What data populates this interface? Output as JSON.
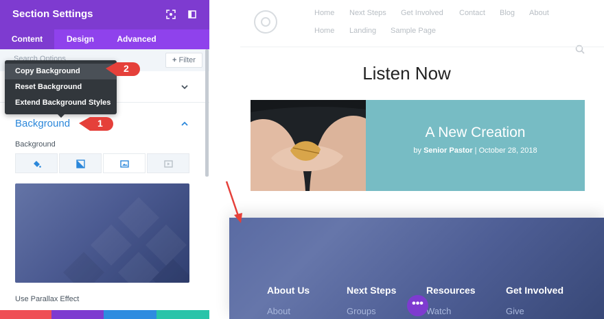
{
  "panel": {
    "title": "Section Settings",
    "tabs": [
      "Content",
      "Design",
      "Advanced"
    ],
    "active_tab": "Content",
    "search_placeholder": "Search Options",
    "filter_label": "Filter",
    "background_section_title": "Background",
    "background_field_label": "Background",
    "background_type_tabs": [
      "paint-bucket-icon",
      "gradient-icon",
      "image-icon",
      "video-icon"
    ],
    "parallax_label": "Use Parallax Effect",
    "accent_color": "#7e3bd0",
    "bottom_bar_colors": [
      "#ef4f56",
      "#7e3bd0",
      "#2e8ce0",
      "#29c4a9"
    ]
  },
  "context_menu": {
    "items": [
      "Copy Background",
      "Reset Background",
      "Extend Background Styles"
    ],
    "highlighted": "Copy Background"
  },
  "callouts": [
    "1",
    "2"
  ],
  "preview": {
    "nav_links": [
      "Home",
      "Next Steps",
      "Get Involved",
      "Contact",
      "Blog",
      "About",
      "Home",
      "Landing",
      "Sample Page"
    ],
    "section_title": "Listen Now",
    "post": {
      "title": "A New Creation",
      "by": "by",
      "author": "Senior Pastor",
      "separator": "|",
      "date": "October 28, 2018"
    },
    "footer_columns": [
      {
        "heading": "About Us",
        "link": "About"
      },
      {
        "heading": "Next Steps",
        "link": "Groups"
      },
      {
        "heading": "Resources",
        "link": "Watch"
      },
      {
        "heading": "Get Involved",
        "link": "Give"
      }
    ],
    "more_button": "•••"
  }
}
